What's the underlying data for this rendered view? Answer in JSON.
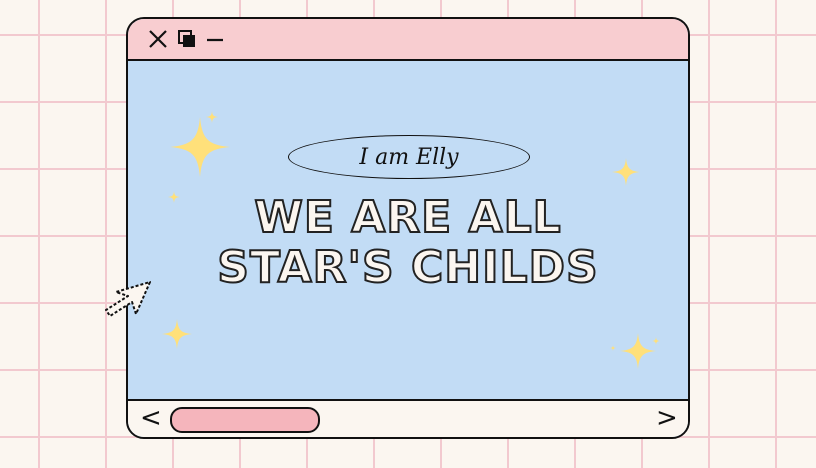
{
  "window": {
    "controls": {
      "close_icon": "close-icon",
      "restore_icon": "restore-icon",
      "minimize_icon": "minimize-icon"
    }
  },
  "content": {
    "pill_text": "I am Elly",
    "headline_line1": "WE ARE ALL",
    "headline_line2": "STAR'S CHILDS"
  },
  "bottombar": {
    "prev_label": "<",
    "next_label": ">"
  },
  "colors": {
    "background": "#fbf6f0",
    "grid": "#f2c9cf",
    "titlebar": "#f8cdd0",
    "window_body": "#c2dcf5",
    "star": "#ffe07a",
    "scroll_thumb": "#f5b5bc",
    "outline": "#111111"
  },
  "icons": [
    "close-icon",
    "restore-icon",
    "minimize-icon",
    "sparkle-icon",
    "cursor-arrow-icon"
  ]
}
